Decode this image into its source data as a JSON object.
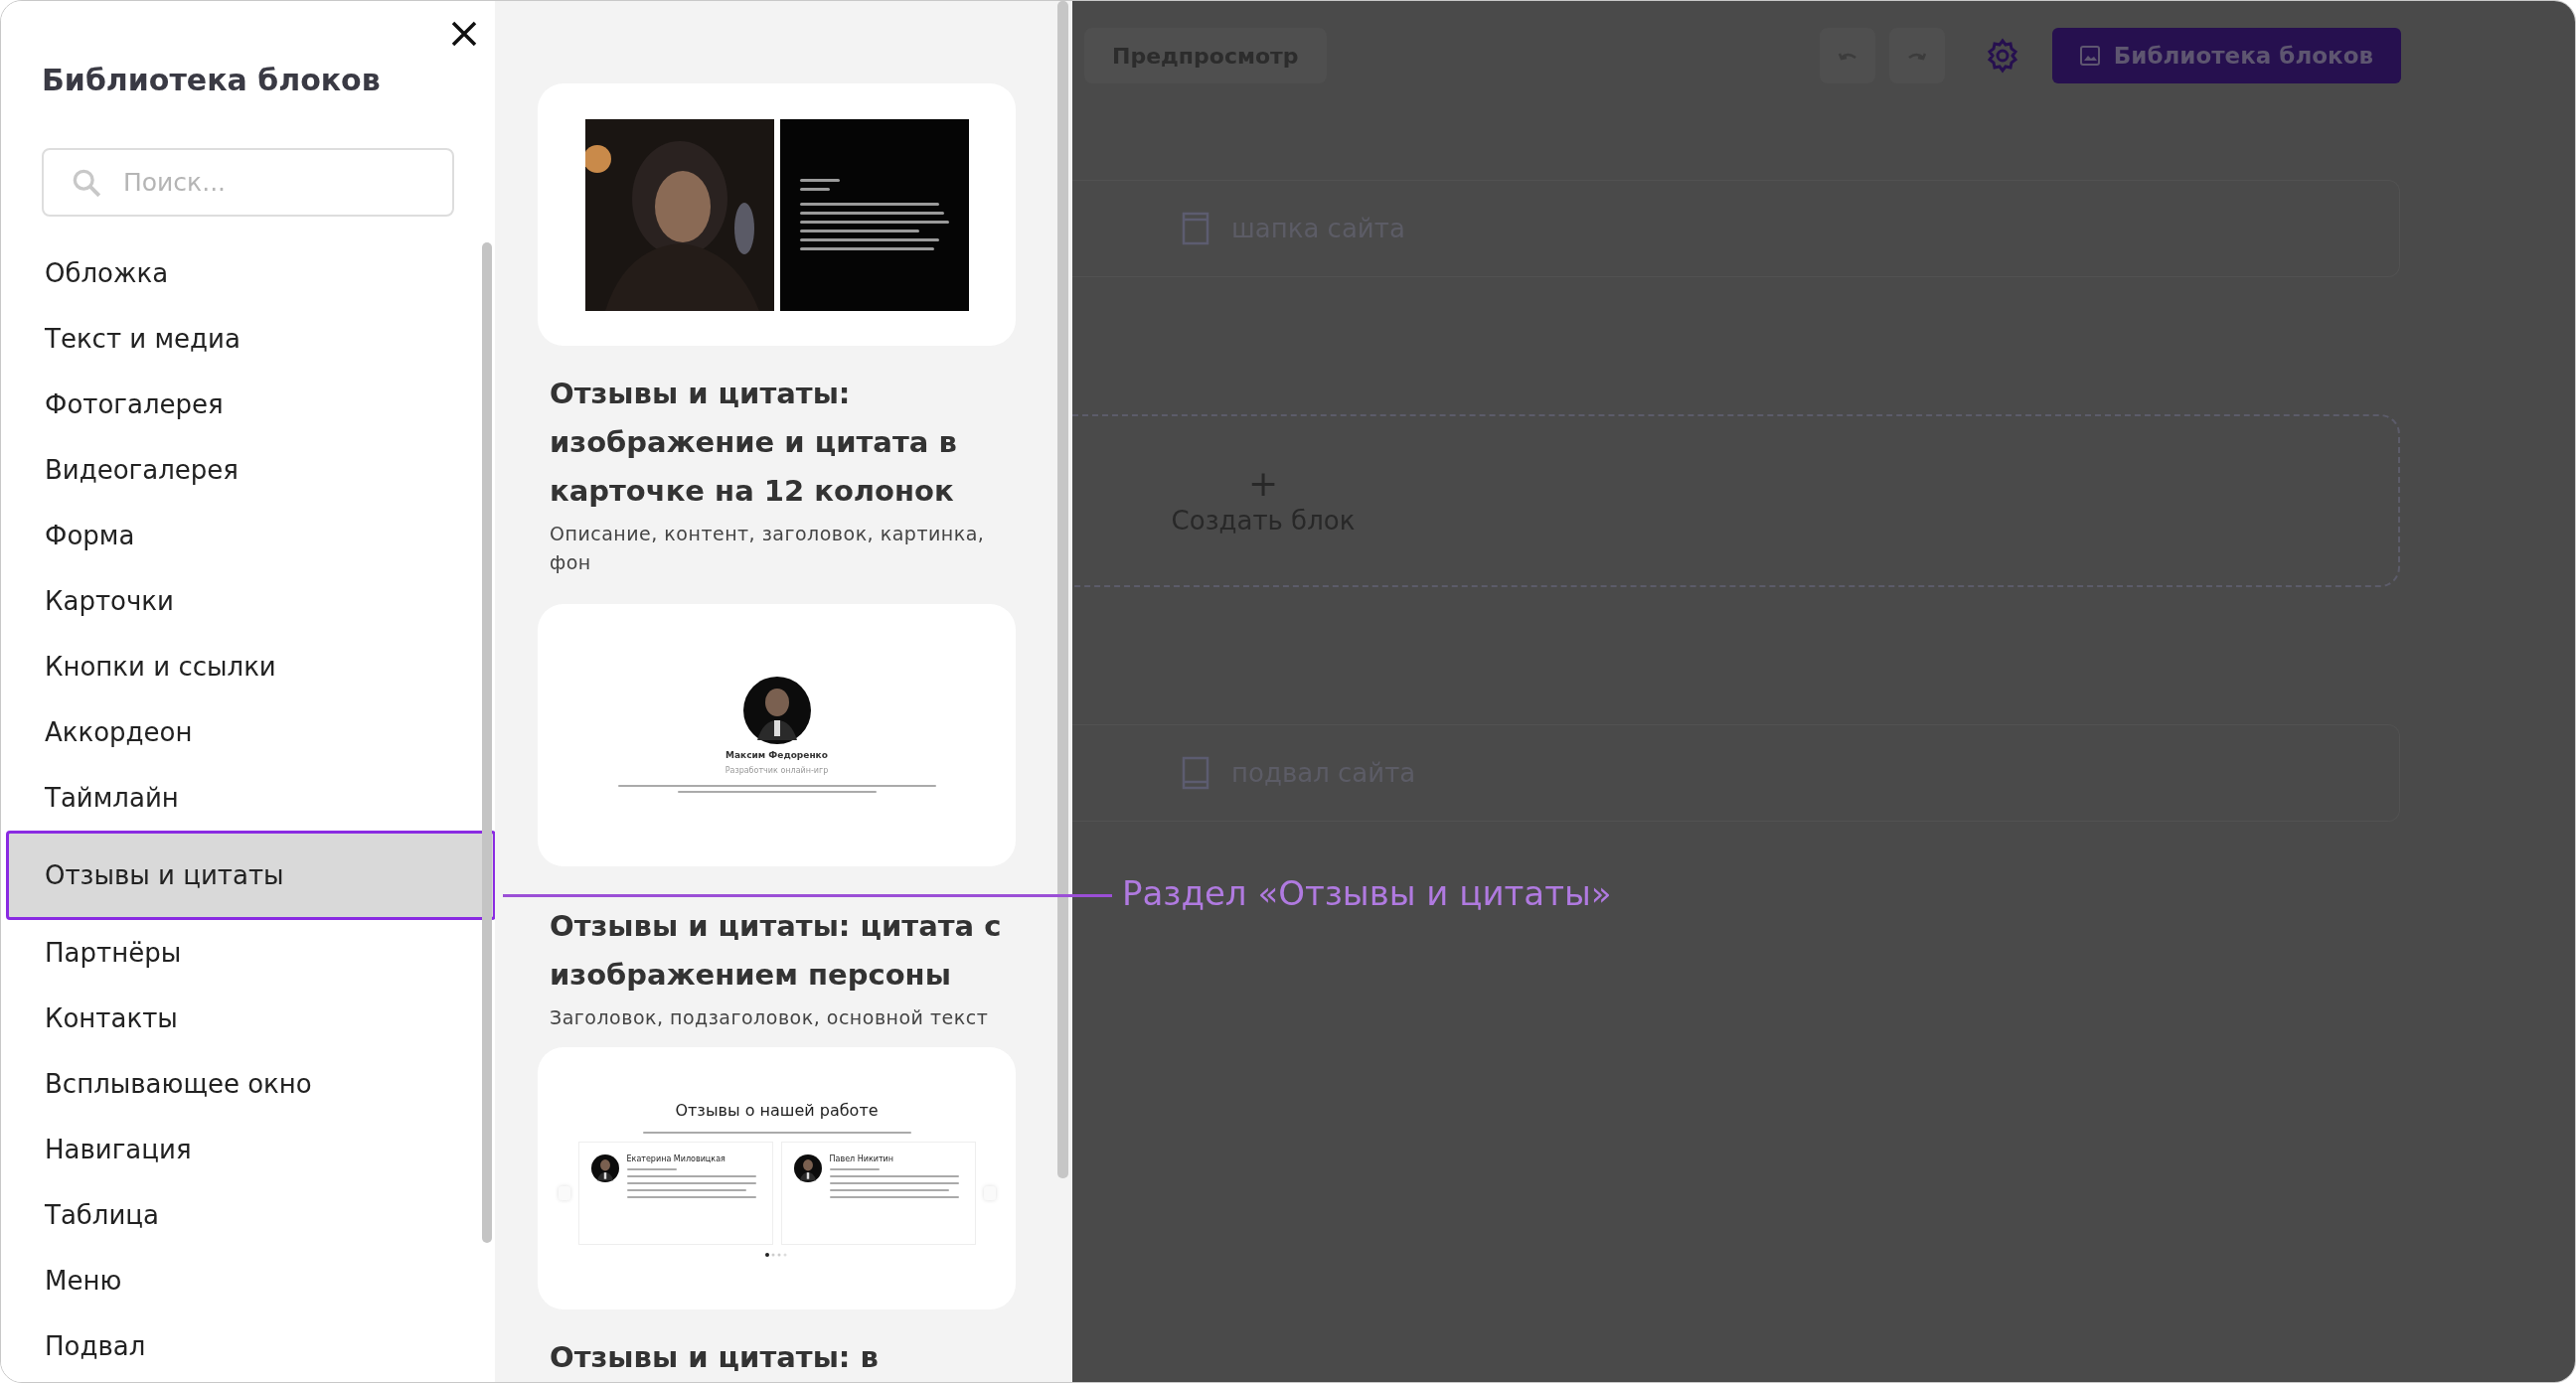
{
  "library": {
    "title": "Библиотека блоков",
    "search": {
      "placeholder": "Поиск..."
    },
    "categories": [
      {
        "label": "Обложка",
        "selected": false
      },
      {
        "label": "Текст и медиа",
        "selected": false
      },
      {
        "label": "Фотогалерея",
        "selected": false
      },
      {
        "label": "Видеогалерея",
        "selected": false
      },
      {
        "label": "Форма",
        "selected": false
      },
      {
        "label": "Карточки",
        "selected": false
      },
      {
        "label": "Кнопки и ссылки",
        "selected": false
      },
      {
        "label": "Аккордеон",
        "selected": false
      },
      {
        "label": "Таймлайн",
        "selected": false
      },
      {
        "label": "Отзывы и цитаты",
        "selected": true
      },
      {
        "label": "Партнёры",
        "selected": false
      },
      {
        "label": "Контакты",
        "selected": false
      },
      {
        "label": "Всплывающее окно",
        "selected": false
      },
      {
        "label": "Навигация",
        "selected": false
      },
      {
        "label": "Таблица",
        "selected": false
      },
      {
        "label": "Меню",
        "selected": false
      },
      {
        "label": "Подвал",
        "selected": false
      }
    ]
  },
  "blocks": [
    {
      "kind": "split",
      "title": "Отзывы и цитаты: изображение и цитата в карточке на 12 колонок",
      "tags": "Описание, контент, заголовок, картинка, фон"
    },
    {
      "kind": "person",
      "title": "Отзывы и цитаты: цитата с изображением персоны",
      "tags": "Заголовок, подзаголовок, основной текст",
      "preview": {
        "name": "Максим Федоренко",
        "role": "Разработчик онлайн-игр"
      }
    },
    {
      "kind": "carousel",
      "title": "Отзывы и цитаты: в",
      "preview": {
        "heading": "Отзывы о нашей работе",
        "reviews": [
          {
            "name": "Екатерина Миловицкая"
          },
          {
            "name": "Павел Никитин"
          }
        ]
      }
    }
  ],
  "editor": {
    "preview_button": "Предпросмотр",
    "library_button": "Библиотека блоков",
    "header_row": "шапка сайта",
    "create_block": {
      "icon": "+",
      "label": "Создать блок"
    },
    "footer_row": "подвал сайта"
  },
  "annotation": {
    "label": "Раздел «Отзывы и цитаты»"
  }
}
